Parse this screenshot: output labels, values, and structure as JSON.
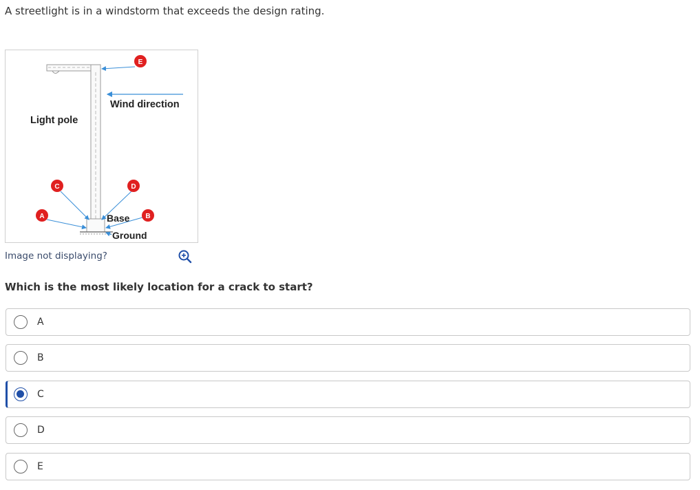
{
  "prompt": "A streetlight is in a windstorm that exceeds the design rating.",
  "figure": {
    "labels": {
      "light_pole": "Light pole",
      "wind_direction": "Wind direction",
      "base": "Base",
      "ground": "Ground"
    },
    "markers": {
      "a": "A",
      "b": "B",
      "c": "C",
      "d": "D",
      "e": "E"
    },
    "colors": {
      "marker": "#e02020",
      "arrow": "#3a8fd8"
    }
  },
  "image_help": "Image not displaying?",
  "question": "Which is the most likely location for a crack to start?",
  "options": [
    {
      "label": "A",
      "selected": false
    },
    {
      "label": "B",
      "selected": false
    },
    {
      "label": "C",
      "selected": true
    },
    {
      "label": "D",
      "selected": false
    },
    {
      "label": "E",
      "selected": false
    }
  ],
  "accent": "#1f4fa8"
}
